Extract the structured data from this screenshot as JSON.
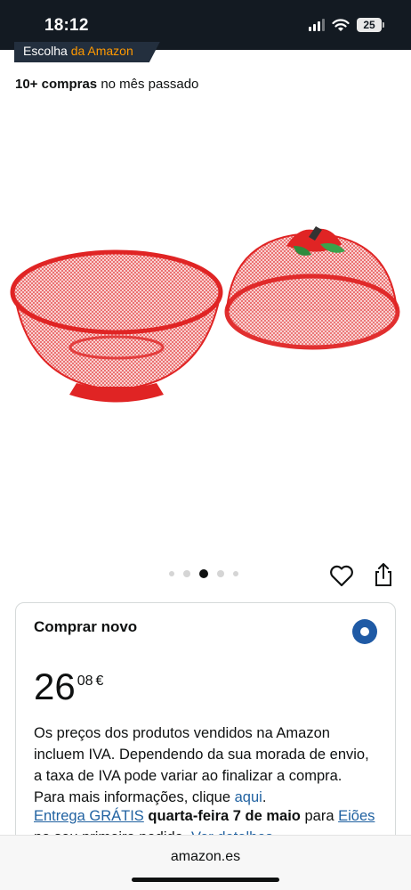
{
  "status_bar": {
    "time": "18:12",
    "battery": "25"
  },
  "badge": {
    "prefix": "Escolha",
    "brand": "da Amazon"
  },
  "bought": {
    "count": "10+ compras",
    "period": "no mês passado"
  },
  "product": {
    "image_alt": "product-image"
  },
  "carousel": {
    "total": 5,
    "active_index": 2
  },
  "buy_box": {
    "title": "Comprar novo",
    "price_whole": "26",
    "price_fraction": "08",
    "currency": "€",
    "vat_text": "Os preços dos produtos vendidos na Amazon incluem IVA. Dependendo da sua morada de envio, a taxa de IVA pode variar ao finalizar a compra. Para mais informações, clique",
    "vat_link": "aqui",
    "vat_end": ".",
    "delivery_link": "Entrega GRÁTIS",
    "delivery_date": "quarta-feira 7 de maio",
    "delivery_to": "para",
    "location_link": "Eiões",
    "delivery_rest": "no seu primeiro pedido.",
    "details_link": "Ver detalhes"
  },
  "browser": {
    "url": "amazon.es"
  },
  "colors": {
    "accent": "#ff9900",
    "link": "#2162a1",
    "radio": "#1f5aa5"
  }
}
